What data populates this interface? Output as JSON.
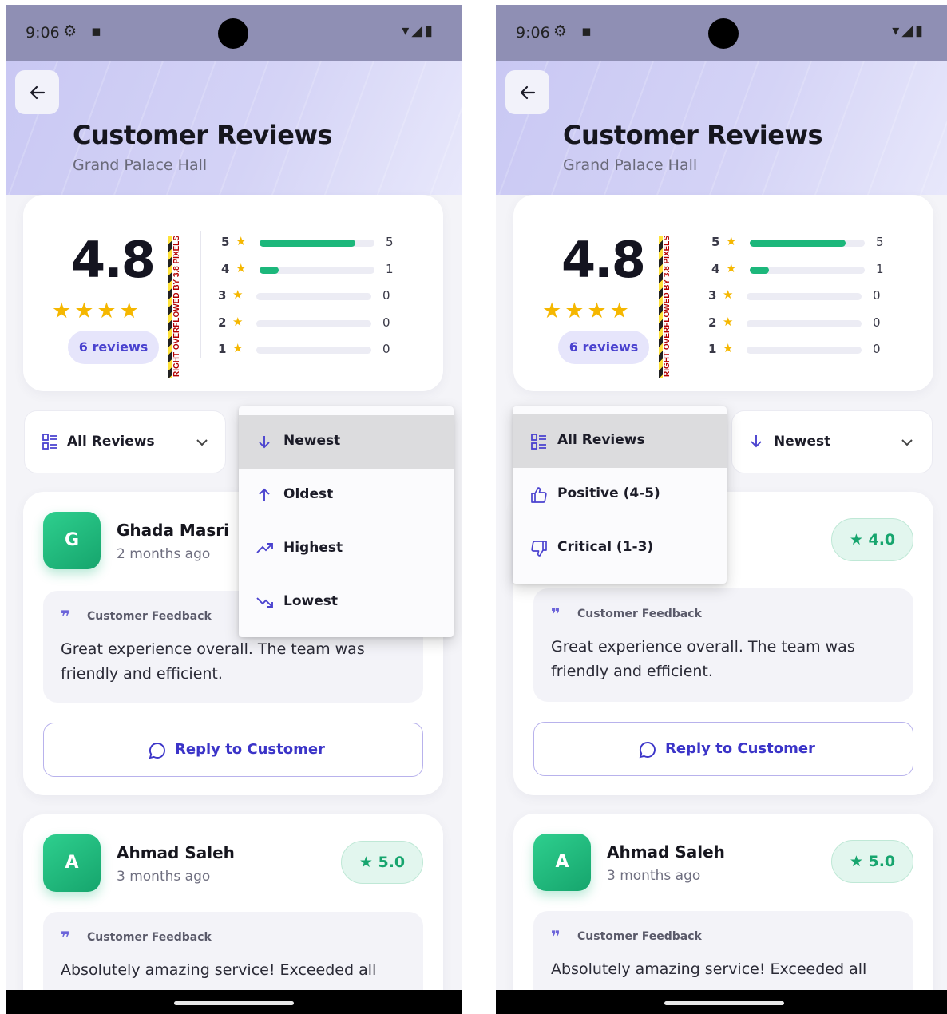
{
  "status": {
    "time": "9:06",
    "left_icons": "⚙ ▪",
    "right_icons": "▾◢▮"
  },
  "header": {
    "title": "Customer Reviews",
    "subtitle": "Grand Palace Hall"
  },
  "summary": {
    "rating": "4.8",
    "stars": "★★★★",
    "review_count": "6 reviews",
    "overflow_warning": "RIGHT OVERFLOWED BY 3.8 PIXELS",
    "distribution": [
      {
        "stars": "5",
        "count": "5",
        "fraction": 0.833
      },
      {
        "stars": "4",
        "count": "1",
        "fraction": 0.167
      },
      {
        "stars": "3",
        "count": "0",
        "fraction": 0
      },
      {
        "stars": "2",
        "count": "0",
        "fraction": 0
      },
      {
        "stars": "1",
        "count": "0",
        "fraction": 0
      }
    ]
  },
  "filters": {
    "review_filter": "All Reviews",
    "sort": "Newest"
  },
  "sort_menu": [
    "Newest",
    "Oldest",
    "Highest",
    "Lowest"
  ],
  "filter_menu": [
    "All Reviews",
    "Positive (4-5)",
    "Critical (1-3)"
  ],
  "reviews": [
    {
      "initial": "G",
      "name": "Ghada Masri",
      "time": "2 months ago",
      "rating": "4.0",
      "feedback_label": "Customer Feedback",
      "text": "Great experience overall. The team was friendly and efficient.",
      "reply": "Reply to Customer"
    },
    {
      "initial": "A",
      "name": "Ahmad Saleh",
      "time": "3 months ago",
      "rating": "5.0",
      "feedback_label": "Customer Feedback",
      "text": "Absolutely amazing service! Exceeded all"
    }
  ],
  "colors": {
    "accent": "#4a42cf",
    "green": "#1cb77b",
    "star": "#f5b700"
  }
}
